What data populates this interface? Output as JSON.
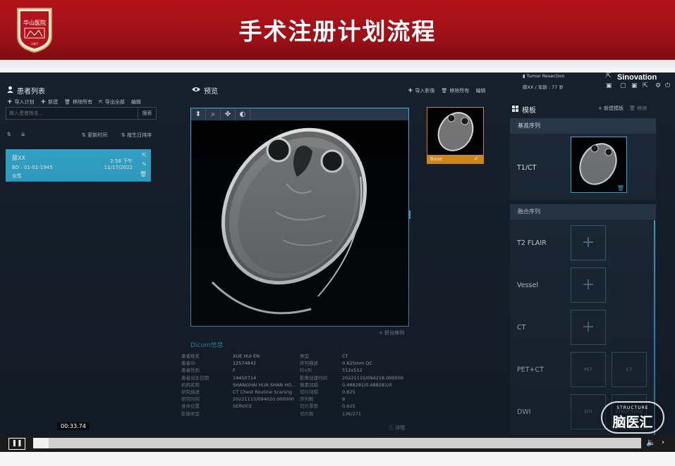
{
  "slide": {
    "title": "手术注册计划流程",
    "logo_text": "HUASHAN HOSPITAL FUDAN UNIVERSITY"
  },
  "left_panel": {
    "title": "患者列表",
    "actions": [
      "导入计划",
      "新建",
      "移除所有",
      "导出全部",
      "编辑"
    ],
    "search_placeholder": "输入患者姓名...",
    "search_button": "搜索",
    "sort_options": [
      "更新时间",
      "按生日排序"
    ],
    "patient": {
      "name": "薛XX",
      "birthdate": "BD : 01-01-1945",
      "sex": "女性",
      "time": "2:58 下午",
      "date": "11/17/2022"
    }
  },
  "center_panel": {
    "title": "预览",
    "actions": [
      "导入影像",
      "移除所有",
      "编辑"
    ],
    "thumbnail_label": "Base",
    "split_sequence_link": "折分序列",
    "dicom_title": "Dicom信息",
    "dicom_left": [
      {
        "label": "患者姓名",
        "value": "XUE HUI EN"
      },
      {
        "label": "患者ID",
        "value": "12574842"
      },
      {
        "label": "患者性别",
        "value": "F"
      },
      {
        "label": "患者出生日期",
        "value": "19450714"
      },
      {
        "label": "机构名称",
        "value": "SHANGHAI HUA SHAN HO..."
      },
      {
        "label": "研究描述",
        "value": "CT Chest Routine Scaning"
      },
      {
        "label": "研究时间",
        "value": "20221115/094020.000000"
      },
      {
        "label": "身体位置",
        "value": "SERVICE"
      },
      {
        "label": "影像类型",
        "value": ""
      }
    ],
    "dicom_right": [
      {
        "label": "类型",
        "value": "CT"
      },
      {
        "label": "序列描述",
        "value": "0.625mm QC"
      },
      {
        "label": "行x列",
        "value": "512x512"
      },
      {
        "label": "影像创建时间",
        "value": "20221115/094218.000000"
      },
      {
        "label": "像素间隔",
        "value": "0.488281/0.488281/0"
      },
      {
        "label": "切片间隔",
        "value": "0.625"
      },
      {
        "label": "序列数",
        "value": "8"
      },
      {
        "label": "切片厚度",
        "value": "0.625"
      },
      {
        "label": "切片数",
        "value": "136/271"
      }
    ],
    "detail_link": "详情"
  },
  "right_panel": {
    "header_case": "Tumor Resection",
    "header_patient": "薛XX / 年龄 : 77 岁",
    "brand": "Sinovation",
    "title": "模板",
    "actions": [
      "新建模板",
      "移除"
    ],
    "base_section": "基准序列",
    "base_row": "T1/CT",
    "fusion_section": "融合序列",
    "fusion_rows": [
      {
        "label": "T2 FLAIR",
        "slots": [
          "+"
        ]
      },
      {
        "label": "Vessel",
        "slots": [
          "+"
        ]
      },
      {
        "label": "CT",
        "slots": [
          "+"
        ]
      },
      {
        "label": "PET+CT",
        "slots": [
          "PET",
          "CT"
        ]
      },
      {
        "label": "DWI",
        "slots": [
          "DTI",
          "STRUCTURE"
        ]
      }
    ]
  },
  "video": {
    "timecode": "00:33.74",
    "progress": 0.025
  },
  "watermark": {
    "small": "STRUCTURE",
    "big": "脑医汇"
  },
  "colors": {
    "banner": "#a8121a",
    "app_bg": "#16202c",
    "accent": "#35b0d6",
    "base_badge": "#e8961d"
  }
}
